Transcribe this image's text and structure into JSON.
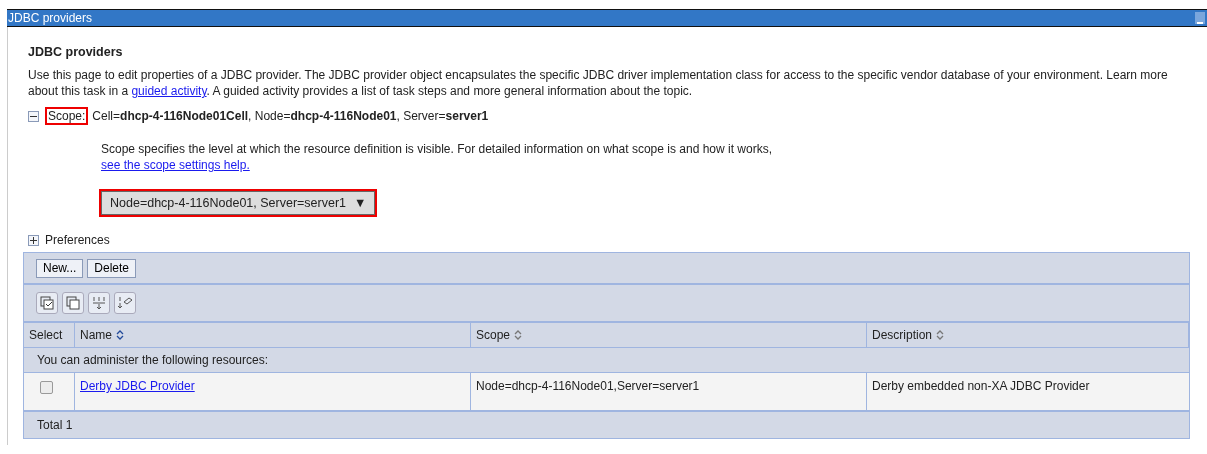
{
  "window": {
    "title": "JDBC providers"
  },
  "heading": "JDBC providers",
  "intro": {
    "before": "Use this page to edit properties of a JDBC provider. The JDBC provider object encapsulates the specific JDBC driver implementation class for access to the specific vendor database of your environment. Learn more about this task in a",
    "link": "guided activity",
    "after": ". A guided activity provides a list of task steps and more general information about the topic."
  },
  "scope": {
    "expanded": true,
    "label": "Scope:",
    "highlighted": true,
    "value": "Cell=**dhcp-4-116Node01Cell**, Node=**dhcp-4-116Node01**, Server=**server1**",
    "help_before": "Scope specifies the level at which the resource definition is visible. For detailed information on what scope is and how it works,",
    "help_link": "see the scope settings help.",
    "select": {
      "value": "Node=dhcp-4-116Node01, Server=server1",
      "arrow": "▼",
      "highlighted": true
    }
  },
  "preferences": {
    "label": "Preferences",
    "expanded": false
  },
  "buttons": [
    "New...",
    "Delete"
  ],
  "table": {
    "columns": [
      {
        "label": "Select",
        "kind": "plain"
      },
      {
        "label": "Name",
        "kind": "sortable",
        "sorted": true
      },
      {
        "label": "Scope",
        "kind": "sortable",
        "sorted": false
      },
      {
        "label": "Description",
        "kind": "sortable",
        "sorted": false
      }
    ],
    "group_label": "You can administer the following resources:",
    "rows": [
      {
        "checked": false,
        "name": "Derby JDBC Provider",
        "scope": "Node=dhcp-4-116Node01,Server=server1",
        "description": "Derby embedded non-XA JDBC Provider"
      }
    ],
    "total": "Total 1"
  }
}
